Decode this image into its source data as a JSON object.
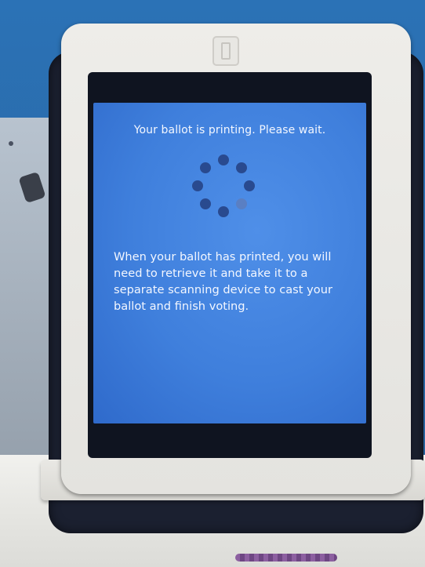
{
  "screen": {
    "status_message": "Your ballot is printing. Please wait.",
    "instructions": "When your ballot has printed, you will need to retrieve it and take it to a separate scanning device to cast your ballot and finish voting.",
    "spinner": {
      "dot_count": 8,
      "faded_dot_index": 3
    }
  },
  "colors": {
    "screen_blue": "#3f7fdc",
    "spinner_dot": "#294a8f",
    "frame_white": "#eeede9",
    "case_dark": "#1b2030",
    "booth_blue": "#2a6aa8"
  }
}
